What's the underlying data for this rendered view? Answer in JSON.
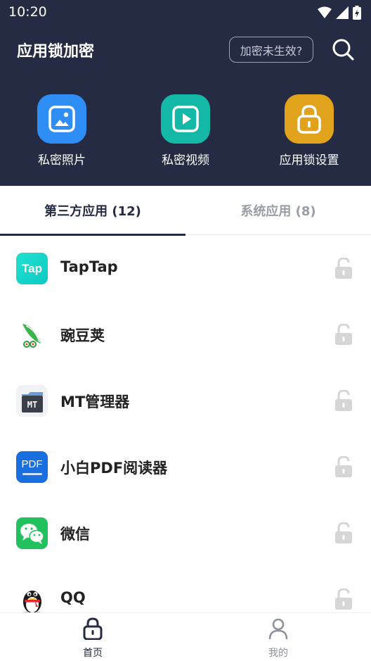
{
  "status_bar": {
    "time": "10:20"
  },
  "header": {
    "title": "应用锁加密",
    "hint_button": "加密未生效?",
    "quick_actions": [
      {
        "label": "私密照片",
        "icon": "photo-icon",
        "color": "#2f8ef5"
      },
      {
        "label": "私密视频",
        "icon": "video-play-icon",
        "color": "#13b9a6"
      },
      {
        "label": "应用锁设置",
        "icon": "lock-settings-icon",
        "color": "#e2a31c"
      }
    ]
  },
  "tabs": [
    {
      "label": "第三方应用 (12)",
      "active": true
    },
    {
      "label": "系统应用 (8)",
      "active": false
    }
  ],
  "apps": [
    {
      "name": "TapTap",
      "icon": "taptap-icon",
      "icon_text": "Tap",
      "locked": false
    },
    {
      "name": "豌豆荚",
      "icon": "wandoujia-icon",
      "locked": false
    },
    {
      "name": "MT管理器",
      "icon": "mt-manager-icon",
      "icon_text": "MT",
      "locked": false
    },
    {
      "name": "小白PDF阅读器",
      "icon": "pdf-reader-icon",
      "icon_text": "PDF",
      "locked": false
    },
    {
      "name": "微信",
      "icon": "wechat-icon",
      "locked": false
    },
    {
      "name": "QQ",
      "icon": "qq-icon",
      "locked": false
    }
  ],
  "bottom_nav": [
    {
      "label": "首页",
      "icon": "lock-icon",
      "active": true
    },
    {
      "label": "我的",
      "icon": "person-icon",
      "active": false
    }
  ],
  "colors": {
    "header_bg": "#252b42",
    "accent": "#252b42",
    "inactive_text": "#9a9da6",
    "unlock_gray": "#d6d6d6"
  }
}
